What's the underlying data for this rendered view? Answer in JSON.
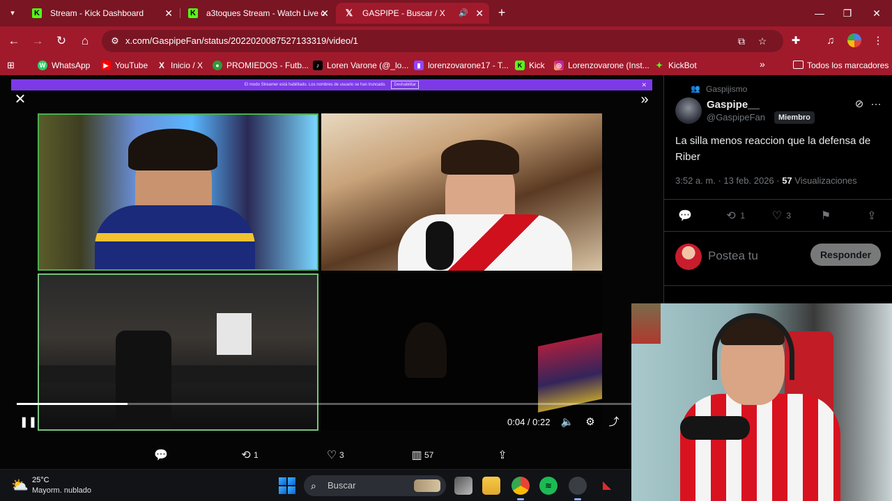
{
  "browser": {
    "tabs": [
      {
        "title": "Stream - Kick Dashboard",
        "icon": "kick-icon",
        "active": false
      },
      {
        "title": "a3toques Stream - Watch Live c",
        "icon": "kick-icon",
        "active": false
      },
      {
        "title": "GASPIPE - Buscar / X",
        "icon": "x-icon",
        "active": true
      }
    ],
    "url": "x.com/GaspipeFan/status/2022020087527133319/video/1",
    "bookmarks": [
      {
        "label": "WhatsApp",
        "icon": "W"
      },
      {
        "label": "YouTube",
        "icon": "▶"
      },
      {
        "label": "Inicio / X",
        "icon": "X"
      },
      {
        "label": "PROMIEDOS - Futb...",
        "icon": "●"
      },
      {
        "label": "Loren Varone (@_lo...",
        "icon": "♪"
      },
      {
        "label": "lorenzovarone17 - T...",
        "icon": "▮"
      },
      {
        "label": "Kick",
        "icon": "K"
      },
      {
        "label": "Lorenzovarone (Inst...",
        "icon": "◎"
      },
      {
        "label": "KickBot",
        "icon": "✦"
      }
    ],
    "bookmarks_folder": "Todos los marcadores"
  },
  "media": {
    "streamer_banner": "El modo Streamer está habilitado. Los nombres de usuario se han truncado.",
    "streamer_banner_button": "Deshabilitar",
    "time": "0:04 / 0:22",
    "progress": 0.18,
    "actions": {
      "replies": "",
      "reposts": "1",
      "likes": "3",
      "views": "57"
    }
  },
  "tweet": {
    "community": "Gaspijismo",
    "display_name": "Gaspipe__",
    "handle": "@GaspipeFan",
    "badge": "Miembro",
    "text": "La silla menos reaccion que la defensa de Riber",
    "time": "3:52 a. m. · 13 feb. 2026 · ",
    "views_count": "57",
    "views_label": "Visualizaciones",
    "reposts": "1",
    "likes": "3",
    "reply_placeholder": "Postea tu",
    "reply_button": "Responder"
  },
  "taskbar": {
    "temperature": "25°C",
    "weather": "Mayorm. nublado",
    "search_placeholder": "Buscar"
  }
}
